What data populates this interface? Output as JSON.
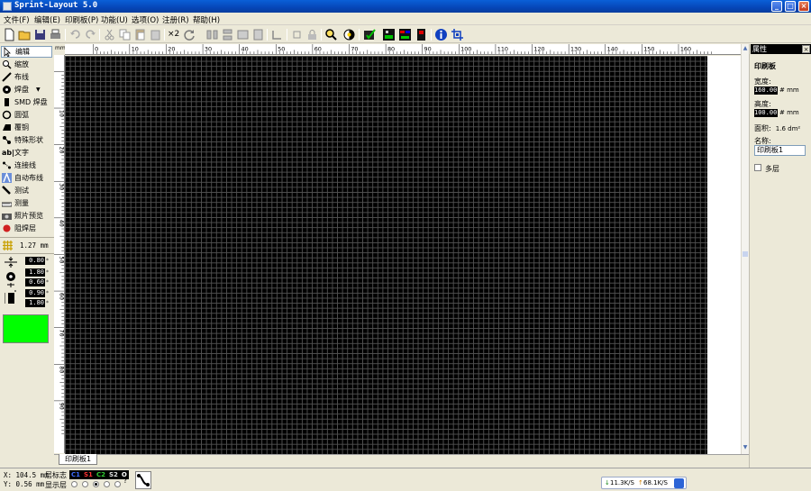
{
  "window": {
    "title": "Sprint-Layout 5.0"
  },
  "menu": [
    {
      "label": "文件(F)"
    },
    {
      "label": "编辑(E)"
    },
    {
      "label": "印刷板(P)"
    },
    {
      "label": "功能(U)"
    },
    {
      "label": "选项(O)"
    },
    {
      "label": "注册(R)"
    },
    {
      "label": "帮助(H)"
    }
  ],
  "toolbar": {
    "multiply_label": "×2",
    "icons": [
      "new-file-icon",
      "open-folder-icon",
      "save-icon",
      "print-icon",
      "undo-icon",
      "redo-icon",
      "cut-icon",
      "copy-icon",
      "paste-icon",
      "delete-icon",
      "duplicate-icon",
      "rotate-icon",
      "mirror-h-icon",
      "mirror-v-icon",
      "align-icon",
      "group-icon",
      "ungroup-icon",
      "snap-icon",
      "zoom-icon",
      "contrast-icon",
      "drc-icon",
      "layer-green-icon",
      "layer-multi-icon",
      "component-icon",
      "info-icon",
      "crosshair-icon"
    ]
  },
  "tools": [
    {
      "label": "编辑",
      "icon": "pointer-icon",
      "selected": true
    },
    {
      "label": "缩放",
      "icon": "magnifier-icon"
    },
    {
      "label": "布线",
      "icon": "track-icon"
    },
    {
      "label": "焊盘",
      "icon": "pad-icon"
    },
    {
      "label": "SMD 焊盘",
      "icon": "smd-pad-icon"
    },
    {
      "label": "圆弧",
      "icon": "circle-icon"
    },
    {
      "label": "覆铜",
      "icon": "copper-fill-icon"
    },
    {
      "label": "特殊形状",
      "icon": "special-shape-icon"
    },
    {
      "label": "文字",
      "icon": "text-icon"
    },
    {
      "label": "连接线",
      "icon": "connection-icon"
    },
    {
      "label": "自动布线",
      "icon": "autoroute-icon"
    },
    {
      "label": "测试",
      "icon": "test-icon"
    },
    {
      "label": "测量",
      "icon": "measure-icon"
    },
    {
      "label": "照片预览",
      "icon": "camera-icon"
    },
    {
      "label": "阻焊层",
      "icon": "solder-mask-icon"
    }
  ],
  "grid": {
    "value": "1.27 mm"
  },
  "track_width": "0.80",
  "pad": {
    "outer": "1.80",
    "inner": "0.60"
  },
  "smd": {
    "w": "0.90",
    "h": "1.80"
  },
  "num_unit": "*",
  "ruler": {
    "unit": "mm",
    "top_labels": [
      "0",
      "10",
      "20",
      "30",
      "40",
      "50",
      "60",
      "70",
      "80",
      "90",
      "100",
      "110",
      "120",
      "130",
      "140",
      "150",
      "160"
    ],
    "left_labels": [
      "10",
      "20",
      "30",
      "40",
      "50",
      "60",
      "70",
      "80",
      "90"
    ]
  },
  "tab": {
    "label": "印刷板1"
  },
  "properties": {
    "title": "属性",
    "section": "印刷板",
    "width_label": "宽度:",
    "width_value": "160.00",
    "height_label": "高度:",
    "height_value": "100.00",
    "unit": "mm",
    "area_label": "面积:",
    "area_value": "1.6 dm²",
    "name_label": "名称:",
    "name_value": "印刷板1",
    "multilayer_label": "多层"
  },
  "status": {
    "x": "X: 104.5 mm",
    "y": "Y: 0.56 mm",
    "layer_flag_label": "层标志",
    "layer_show_label": "显示层",
    "layers": [
      {
        "label": "C1",
        "color": "#3d6cff"
      },
      {
        "label": "S1",
        "color": "#ff3333"
      },
      {
        "label": "C2",
        "color": "#33cc33"
      },
      {
        "label": "S2",
        "color": "#e0e0e0"
      },
      {
        "label": "O",
        "color": "#ffffff"
      }
    ],
    "help": "?",
    "download": "11.3K/S",
    "upload": "68.1K/S"
  }
}
